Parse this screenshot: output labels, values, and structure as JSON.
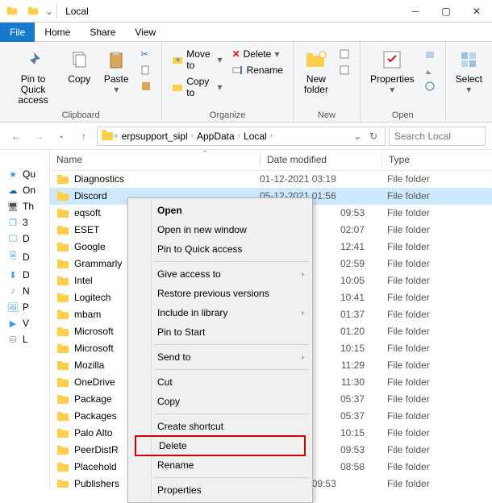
{
  "title_bar": {
    "window_title": "Local"
  },
  "tabs": {
    "file": "File",
    "home": "Home",
    "share": "Share",
    "view": "View"
  },
  "ribbon": {
    "clipboard": {
      "pin": "Pin to Quick\naccess",
      "copy": "Copy",
      "paste": "Paste",
      "cut": "",
      "group": "Clipboard"
    },
    "organize": {
      "moveto": "Move to",
      "copyto": "Copy to",
      "delete": "Delete",
      "rename": "Rename",
      "group": "Organize"
    },
    "new": {
      "newfolder": "New\nfolder",
      "group": "New"
    },
    "open": {
      "properties": "Properties",
      "group": "Open"
    },
    "select": {
      "select": "Select",
      "group": ""
    }
  },
  "breadcrumb": {
    "seg1": "erpsupport_sipl",
    "seg2": "AppData",
    "seg3": "Local"
  },
  "search": {
    "placeholder": "Search Local"
  },
  "quick_access": [
    {
      "icon": "star",
      "label": "Qu",
      "color": "#3a9be8"
    },
    {
      "icon": "cloud",
      "label": "On",
      "color": "#0a64a4"
    },
    {
      "icon": "monitor",
      "label": "Th",
      "color": "#4a4a4a"
    },
    {
      "icon": "cube",
      "label": "3",
      "color": "#3a9be8"
    },
    {
      "icon": "desktop",
      "label": "D",
      "color": "#3a9be8"
    },
    {
      "icon": "doc",
      "label": "D",
      "color": "#3a9be8"
    },
    {
      "icon": "down",
      "label": "D",
      "color": "#3a9be8"
    },
    {
      "icon": "music",
      "label": "N",
      "color": "#3a9be8"
    },
    {
      "icon": "pic",
      "label": "P",
      "color": "#3a9be8"
    },
    {
      "icon": "video",
      "label": "V",
      "color": "#3a9be8"
    },
    {
      "icon": "disk",
      "label": "L",
      "color": "#888"
    }
  ],
  "columns": {
    "name": "Name",
    "date": "Date modified",
    "type": "Type"
  },
  "folder_type": "File folder",
  "rows": [
    {
      "name": "Diagnostics",
      "date": "01-12-2021 03:19"
    },
    {
      "name": "Discord",
      "date": "05-12-2021 01:56",
      "selected": true
    },
    {
      "name": "eqsoft",
      "date": "09:53",
      "partial": true
    },
    {
      "name": "ESET",
      "date": "02:07",
      "partial": true
    },
    {
      "name": "Google",
      "date": "12:41",
      "partial": true
    },
    {
      "name": "Grammarly",
      "date": "02:59",
      "partial": true
    },
    {
      "name": "Intel",
      "date": "10:05",
      "partial": true
    },
    {
      "name": "Logitech",
      "date": "10:41",
      "partial": true
    },
    {
      "name": "mbam",
      "date": "01:37",
      "partial": true
    },
    {
      "name": "Microsoft",
      "date": "01:20",
      "partial": true
    },
    {
      "name": "Microsoft",
      "date": "10:15",
      "partial": true
    },
    {
      "name": "Mozilla",
      "date": "11:29",
      "partial": true
    },
    {
      "name": "OneDrive",
      "date": "11:30",
      "partial": true
    },
    {
      "name": "Package",
      "date": "05:37",
      "partial": true
    },
    {
      "name": "Packages",
      "date": "05:37",
      "partial": true
    },
    {
      "name": "Palo Alto",
      "date": "10:15",
      "partial": true
    },
    {
      "name": "PeerDistR",
      "date": "09:53",
      "partial": true
    },
    {
      "name": "Placehold",
      "date": "08:58",
      "partial": true
    },
    {
      "name": "Publishers",
      "date": "09-02-2021 09:53"
    }
  ],
  "context_menu": {
    "open": "Open",
    "open_new": "Open in new window",
    "pin_qa": "Pin to Quick access",
    "give_access": "Give access to",
    "restore": "Restore previous versions",
    "include_lib": "Include in library",
    "pin_start": "Pin to Start",
    "send_to": "Send to",
    "cut": "Cut",
    "copy": "Copy",
    "shortcut": "Create shortcut",
    "delete": "Delete",
    "rename": "Rename",
    "properties": "Properties"
  }
}
